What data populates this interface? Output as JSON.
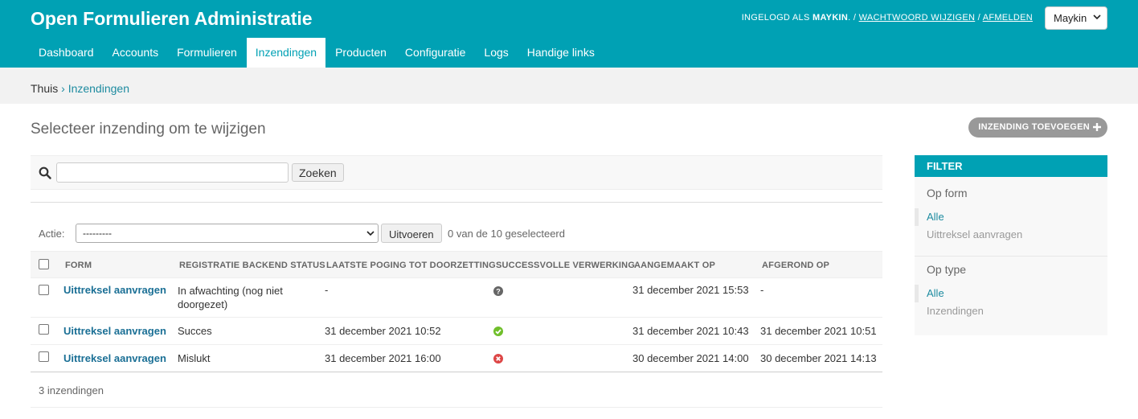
{
  "header": {
    "title": "Open Formulieren Administratie",
    "user_tools": {
      "prefix": "INGELOGD ALS",
      "username": "MAYKIN",
      "change_password": "WACHTWOORD WIJZIGEN",
      "logout": "AFMELDEN",
      "separator": "/"
    },
    "user_select_value": "Maykin"
  },
  "nav": {
    "items": [
      {
        "label": "Dashboard"
      },
      {
        "label": "Accounts"
      },
      {
        "label": "Formulieren"
      },
      {
        "label": "Inzendingen",
        "active": true
      },
      {
        "label": "Producten"
      },
      {
        "label": "Configuratie"
      },
      {
        "label": "Logs"
      },
      {
        "label": "Handige links"
      }
    ]
  },
  "breadcrumbs": {
    "home": "Thuis",
    "separator": "›",
    "current": "Inzendingen"
  },
  "page": {
    "title": "Selecteer inzending om te wijzigen",
    "add_button": "INZENDING TOEVOEGEN"
  },
  "search": {
    "value": "",
    "button": "Zoeken"
  },
  "actions": {
    "label": "Actie:",
    "select_value": "---------",
    "run_button": "Uitvoeren",
    "selection_count": "0 van de 10 geselecteerd"
  },
  "table": {
    "headers": [
      "FORM",
      "REGISTRATIE BACKEND STATUS",
      "LAATSTE POGING TOT DOORZETTING",
      "SUCCESSVOLLE VERWERKING",
      "AANGEMAAKT OP",
      "AFGEROND OP"
    ],
    "rows": [
      {
        "form": "Uittreksel aanvragen",
        "status_line1": "In afwachting (nog niet",
        "status_line2": "doorgezet)",
        "last_attempt": "-",
        "success_icon": "question-icon",
        "created": "31 december 2021 15:53",
        "completed": "-"
      },
      {
        "form": "Uittreksel aanvragen",
        "status_line1": "Succes",
        "status_line2": "",
        "last_attempt": "31 december 2021 10:52",
        "success_icon": "check-icon",
        "created": "31 december 2021 10:43",
        "completed": "31 december 2021 10:51"
      },
      {
        "form": "Uittreksel aanvragen",
        "status_line1": "Mislukt",
        "status_line2": "",
        "last_attempt": "31 december 2021 16:00",
        "success_icon": "cross-icon",
        "created": "30 december 2021 14:00",
        "completed": "30 december 2021 14:13"
      }
    ],
    "result_count": "3 inzendingen"
  },
  "filter": {
    "title": "FILTER",
    "groups": [
      {
        "heading": "Op form",
        "choices": [
          "Alle",
          "Uittreksel aanvragen"
        ]
      },
      {
        "heading": "Op type",
        "choices": [
          "Alle",
          "Inzendingen"
        ]
      }
    ]
  },
  "colors": {
    "brand": "#00a1b4",
    "link": "#1a6f95",
    "success": "#70bf2b",
    "error": "#dd4646",
    "unknown": "#666666"
  }
}
